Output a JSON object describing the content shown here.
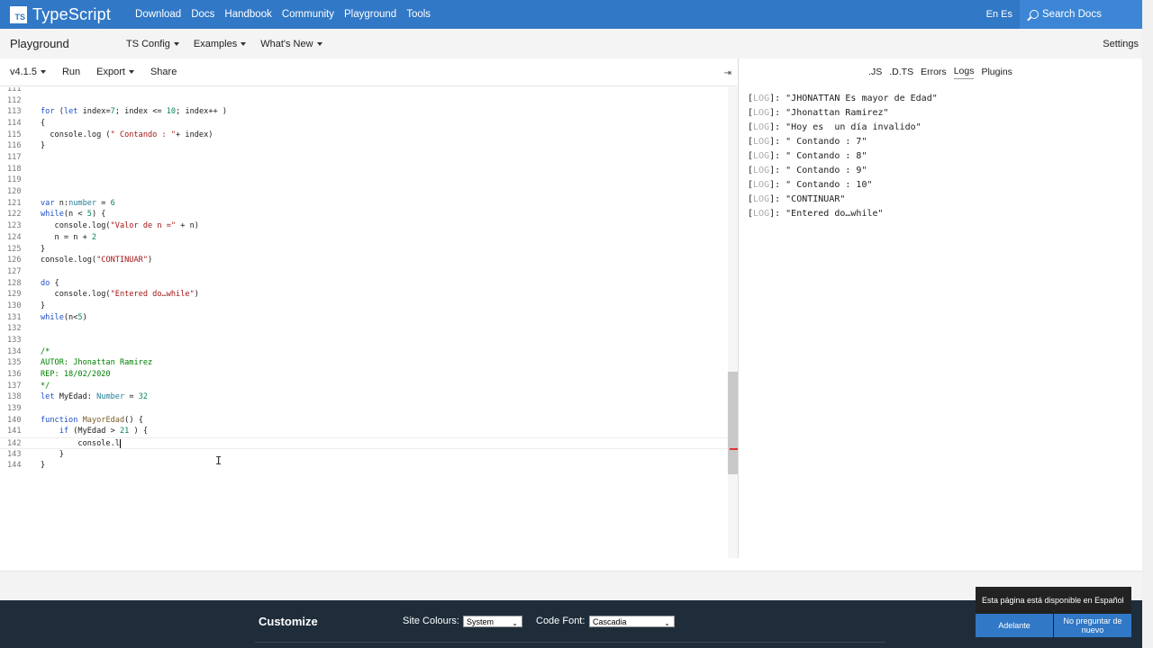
{
  "nav": {
    "logo": "TS",
    "brand": "TypeScript",
    "links": [
      "Download",
      "Docs",
      "Handbook",
      "Community",
      "Playground",
      "Tools"
    ],
    "lang": "En Es",
    "search": "Search Docs"
  },
  "pgbar": {
    "title": "Playground",
    "menus": [
      "TS Config",
      "Examples",
      "What's New"
    ],
    "settings": "Settings"
  },
  "editor_toolbar": {
    "version": "v4.1.5",
    "run": "Run",
    "export": "Export",
    "share": "Share"
  },
  "sidebar": {
    "tabs": [
      ".JS",
      ".D.TS",
      "Errors",
      "Logs",
      "Plugins"
    ],
    "active_tab": "Logs"
  },
  "code_lines": [
    {
      "n": "111",
      "t": ""
    },
    {
      "n": "112",
      "t": ""
    },
    {
      "n": "113",
      "t": "for (let index=7; index <= 10; index++ )"
    },
    {
      "n": "114",
      "t": "{"
    },
    {
      "n": "115",
      "t": "  console.log (\" Contando : \"+ index)"
    },
    {
      "n": "116",
      "t": "}"
    },
    {
      "n": "117",
      "t": ""
    },
    {
      "n": "118",
      "t": ""
    },
    {
      "n": "119",
      "t": ""
    },
    {
      "n": "120",
      "t": ""
    },
    {
      "n": "121",
      "t": "var n:number = 6"
    },
    {
      "n": "122",
      "t": "while(n < 5) {"
    },
    {
      "n": "123",
      "t": "   console.log(\"Valor de n =\" + n)"
    },
    {
      "n": "124",
      "t": "   n = n + 2"
    },
    {
      "n": "125",
      "t": "}"
    },
    {
      "n": "126",
      "t": "console.log(\"CONTINUAR\")"
    },
    {
      "n": "127",
      "t": ""
    },
    {
      "n": "128",
      "t": "do {"
    },
    {
      "n": "129",
      "t": "   console.log(\"Entered do…while\")"
    },
    {
      "n": "130",
      "t": "}"
    },
    {
      "n": "131",
      "t": "while(n<5)"
    },
    {
      "n": "132",
      "t": ""
    },
    {
      "n": "133",
      "t": ""
    },
    {
      "n": "134",
      "t": "/*"
    },
    {
      "n": "135",
      "t": "AUTOR: Jhonattan Ramirez"
    },
    {
      "n": "136",
      "t": "REP: 18/02/2020"
    },
    {
      "n": "137",
      "t": "*/"
    },
    {
      "n": "138",
      "t": "let MyEdad: Number = 32"
    },
    {
      "n": "139",
      "t": ""
    },
    {
      "n": "140",
      "t": "function MayorEdad() {"
    },
    {
      "n": "141",
      "t": "    if (MyEdad > 21 ) {"
    },
    {
      "n": "142",
      "t": "        console.l"
    },
    {
      "n": "143",
      "t": "    }"
    },
    {
      "n": "144",
      "t": "}"
    }
  ],
  "logs": [
    {
      "tag": "LOG",
      "msg": "\"JHONATTAN Es mayor de Edad\""
    },
    {
      "tag": "LOG",
      "msg": "\"Jhonattan Ramirez\""
    },
    {
      "tag": "LOG",
      "msg": "\"Hoy es  un día invalido\""
    },
    {
      "tag": "LOG",
      "msg": "\" Contando : 7\""
    },
    {
      "tag": "LOG",
      "msg": "\" Contando : 8\""
    },
    {
      "tag": "LOG",
      "msg": "\" Contando : 9\""
    },
    {
      "tag": "LOG",
      "msg": "\" Contando : 10\""
    },
    {
      "tag": "LOG",
      "msg": "\"CONTINUAR\""
    },
    {
      "tag": "LOG",
      "msg": "\"Entered do…while\""
    }
  ],
  "footer": {
    "title": "Customize",
    "site_colours_label": "Site Colours:",
    "site_colours_value": "System",
    "code_font_label": "Code Font:",
    "code_font_value": "Cascadia"
  },
  "toast": {
    "message": "Esta página está disponible en Español",
    "accept": "Adelante",
    "dismiss": "No preguntar de nuevo"
  }
}
